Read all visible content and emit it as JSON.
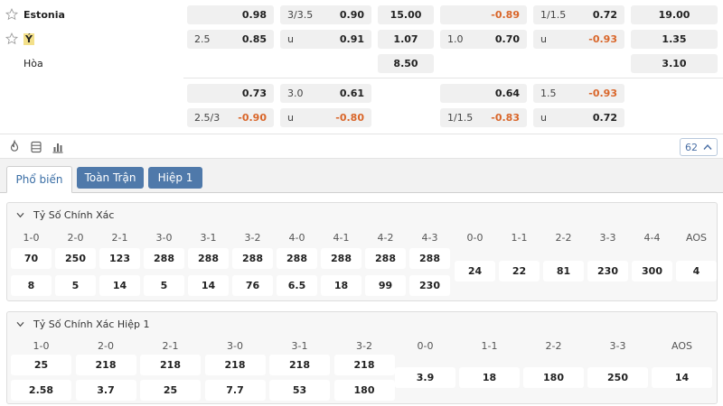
{
  "match": {
    "team1": "Estonia",
    "team2": "Ý",
    "draw": "Hòa"
  },
  "odds_row1": {
    "hdp_home": {
      "label": "",
      "value": "0.98"
    },
    "ou_home": {
      "label": "3/3.5",
      "value": "0.90"
    },
    "x12_home": "15.00",
    "h1_hdp_home": {
      "label": "",
      "value": "-0.89"
    },
    "h1_ou_home": {
      "label": "1/1.5",
      "value": "0.72"
    },
    "h1_x12_home": "19.00",
    "hdp_away": {
      "label": "2.5",
      "value": "0.85"
    },
    "ou_away": {
      "label": "u",
      "value": "0.91"
    },
    "x12_away": "1.07",
    "h1_hdp_away": {
      "label": "1.0",
      "value": "0.70"
    },
    "h1_ou_away": {
      "label": "u",
      "value": "-0.93"
    },
    "h1_x12_away": "1.35",
    "x12_draw": "8.50",
    "h1_x12_draw": "3.10"
  },
  "odds_row2": {
    "hdp_home": {
      "label": "",
      "value": "0.73"
    },
    "ou_home": {
      "label": "3.0",
      "value": "0.61"
    },
    "h1_hdp_home": {
      "label": "",
      "value": "0.64"
    },
    "h1_ou_home": {
      "label": "1.5",
      "value": "-0.93"
    },
    "hdp_away": {
      "label": "2.5/3",
      "value": "-0.90"
    },
    "ou_away": {
      "label": "u",
      "value": "-0.80"
    },
    "h1_hdp_away": {
      "label": "1/1.5",
      "value": "-0.83"
    },
    "h1_ou_away": {
      "label": "u",
      "value": "0.72"
    }
  },
  "toolbar": {
    "count": "62"
  },
  "tabs": [
    {
      "label": "Phổ biến"
    },
    {
      "label": "Toàn Trận"
    },
    {
      "label": "Hiệp 1"
    }
  ],
  "correct_score": {
    "title": "Tỷ Số Chính Xác",
    "home_headers": [
      "1-0",
      "2-0",
      "2-1",
      "3-0",
      "3-1",
      "3-2",
      "4-0",
      "4-1",
      "4-2",
      "4-3"
    ],
    "home_top": [
      "70",
      "250",
      "123",
      "288",
      "288",
      "288",
      "288",
      "288",
      "288",
      "288"
    ],
    "home_bottom": [
      "8",
      "5",
      "14",
      "5",
      "14",
      "76",
      "6.5",
      "18",
      "99",
      "230"
    ],
    "draw_headers": [
      "0-0",
      "1-1",
      "2-2",
      "3-3",
      "4-4",
      "AOS"
    ],
    "draw_values": [
      "24",
      "22",
      "81",
      "230",
      "300",
      "4"
    ]
  },
  "correct_score_h1": {
    "title": "Tỷ Số Chính Xác Hiệp 1",
    "home_headers": [
      "1-0",
      "2-0",
      "2-1",
      "3-0",
      "3-1",
      "3-2"
    ],
    "home_top": [
      "25",
      "218",
      "218",
      "218",
      "218",
      "218"
    ],
    "home_bottom": [
      "2.58",
      "3.7",
      "25",
      "7.7",
      "53",
      "180"
    ],
    "draw_headers": [
      "0-0",
      "1-1",
      "2-2",
      "3-3",
      "AOS"
    ],
    "draw_values": [
      "3.9",
      "18",
      "180",
      "250",
      "14"
    ]
  },
  "colors": {
    "accent": "#4f79aa",
    "negative": "#d9662a"
  }
}
